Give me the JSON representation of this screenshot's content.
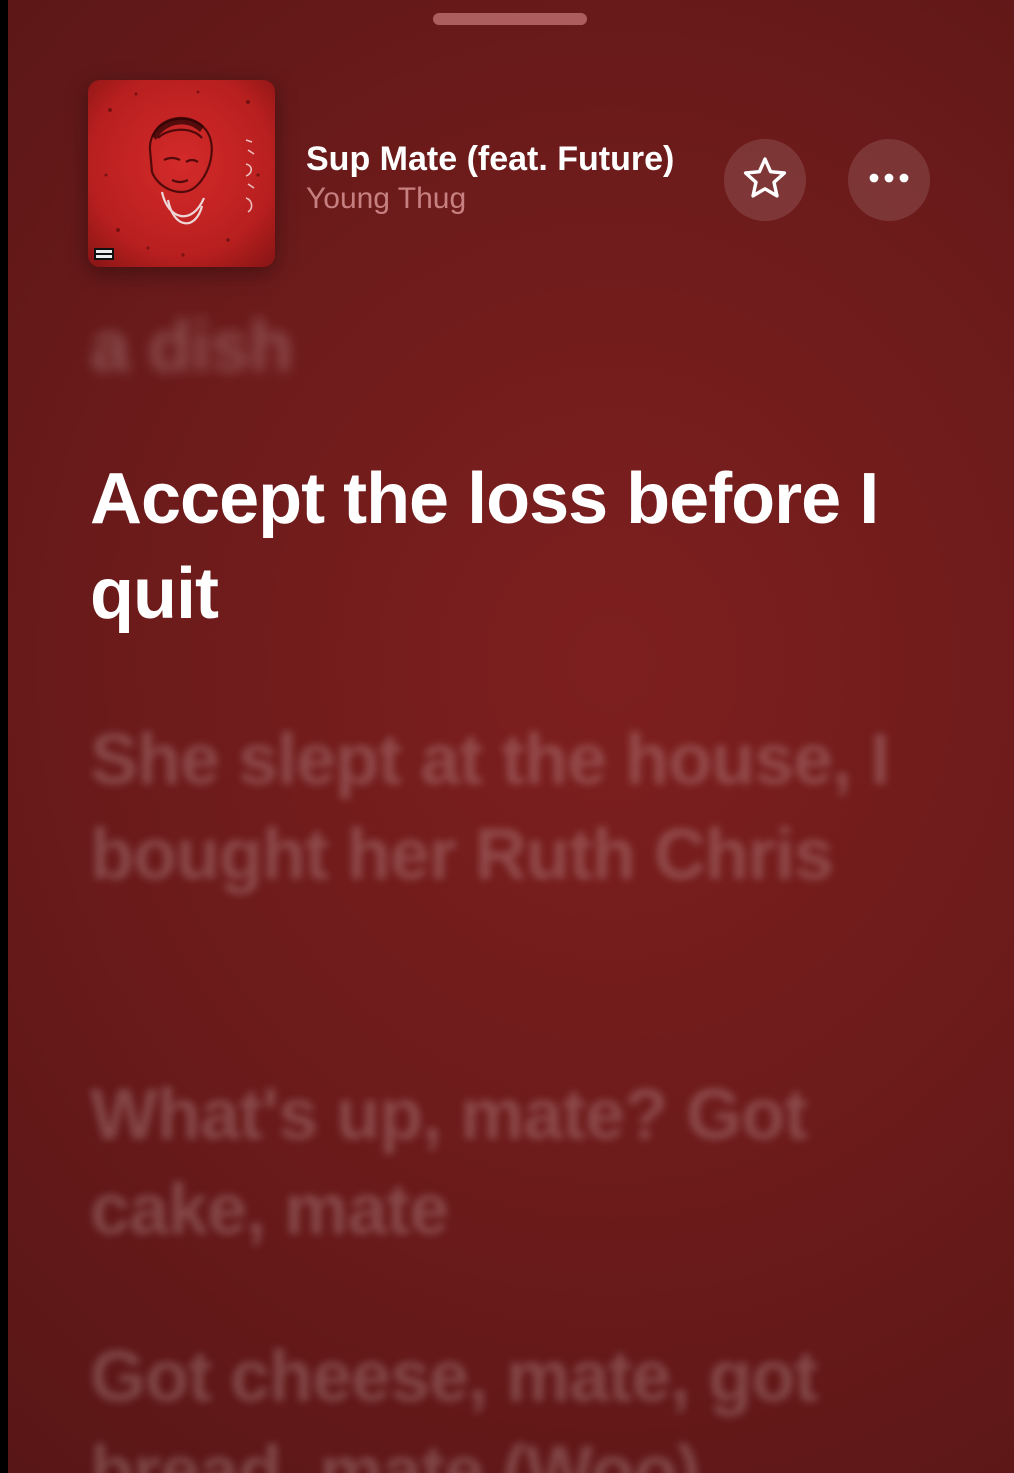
{
  "now_playing": {
    "title": "Sup Mate (feat. Future)",
    "artist": "Young Thug",
    "favorite_icon": "star-icon",
    "more_icon": "ellipsis-icon",
    "artwork": {
      "description": "red album artwork",
      "accent": "#c62525",
      "advisory_label": "PARENTAL ADVISORY"
    }
  },
  "lyrics": {
    "previous_line": "a dish",
    "current_line": "Accept the loss before I quit",
    "upcoming_lines": [
      "She slept at the house, I bought her Ruth Chris",
      "What's up, mate? Got cake, mate",
      "Got cheese, mate, got bread, mate (Woo)"
    ]
  },
  "colors": {
    "background": "#6a1a1a",
    "current_lyric": "#ffffff",
    "dim_lyric": "rgba(255,255,255,0.2)"
  }
}
